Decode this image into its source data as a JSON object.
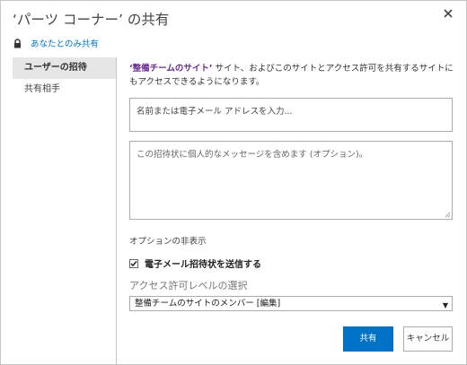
{
  "dialog": {
    "title": "‘パーツ コーナー’ の共有",
    "close_icon": "close-icon"
  },
  "access": {
    "lock_icon": "lock-icon",
    "label": "あなたとのみ共有"
  },
  "sidebar": {
    "items": [
      {
        "label": "ユーザーの招待",
        "selected": true
      },
      {
        "label": "共有相手",
        "selected": false
      }
    ]
  },
  "main": {
    "description": {
      "site_name": "‘整備チームのサイト’",
      "text_line1": " サイト、およびこのサイトとアクセス許可を共有するサイトに",
      "text_line2": "もアクセスできるようになります。"
    },
    "people_input": {
      "placeholder": "名前または電子メール アドレスを入力..."
    },
    "message_input": {
      "placeholder": "この招待状に個人的なメッセージを含めます (オプション)。"
    },
    "options_link": "オプションの非表示",
    "send_email": {
      "label": "電子メール招待状を送信する",
      "checked": true
    },
    "permission": {
      "heading": "アクセス許可レベルの選択",
      "selected": "整備チームのサイトのメンバー [編集]"
    },
    "buttons": {
      "share": "共有",
      "cancel": "キャンセル"
    }
  },
  "colors": {
    "accent": "#0072c6",
    "site_name": "#6b2b8f",
    "selected_nav_bg": "#e6e6e6",
    "border": "#c6c6c6"
  }
}
